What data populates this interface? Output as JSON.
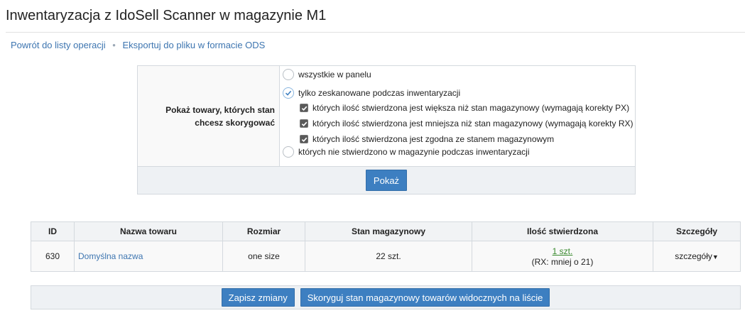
{
  "page": {
    "title": "Inwentaryzacja z IdoSell Scanner w magazynie M1"
  },
  "links": {
    "back": "Powrót do listy operacji",
    "separator": "•",
    "export": "Eksportuj do pliku w formacie ODS"
  },
  "filter": {
    "label_line1": "Pokaż towary, których stan",
    "label_line2": "chcesz skorygować",
    "options": {
      "all": "wszystkie w panelu",
      "scanned": "tylko zeskanowane podczas inwentaryzacji",
      "greater": "których ilość stwierdzona jest większa niż stan magazynowy (wymagają korekty PX)",
      "smaller": "których ilość stwierdzona jest mniejsza niż stan magazynowy (wymagają korekty RX)",
      "equal": "których ilość stwierdzona jest zgodna ze stanem magazynowym",
      "not_found": "których nie stwierdzono w magazynie podczas inwentaryzacji"
    },
    "selected": "scanned",
    "show_button": "Pokaż"
  },
  "table": {
    "headers": {
      "id": "ID",
      "name": "Nazwa towaru",
      "size": "Rozmiar",
      "stock": "Stan magazynowy",
      "counted": "Ilość stwierdzona",
      "details": "Szczegóły"
    },
    "rows": [
      {
        "id": "630",
        "name": "Domyślna nazwa",
        "size": "one size",
        "stock": "22 szt.",
        "counted": "1 szt.",
        "counted_note": "(RX: mniej o 21)",
        "details": "szczegóły"
      }
    ]
  },
  "actions": {
    "save": "Zapisz zmiany",
    "correct": "Skoryguj stan magazynowy towarów widocznych na liście"
  },
  "colors": {
    "accent": "#3d7fc1",
    "link": "#3d75b0",
    "qty_link": "#3a8a2e"
  }
}
